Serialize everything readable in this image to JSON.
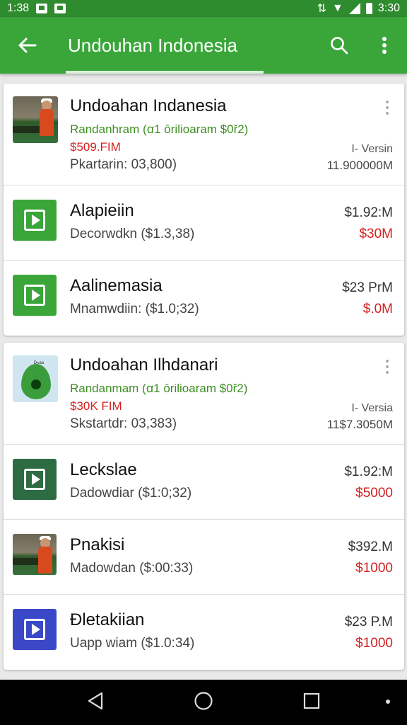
{
  "status": {
    "time_left": "1:38",
    "time_right": "3:30"
  },
  "appbar": {
    "title": "Undouhan Indonesia"
  },
  "cards": [
    {
      "rows": [
        {
          "kind": "featured",
          "icon": "photo",
          "name": "Undoahan Indanesia",
          "subtitle": "Randanhram (ꭤ1 ōrilioaram $0ř2)",
          "price": "$509.FIM",
          "meta": "Pkartarin: 03,800)",
          "version": "I- Versin",
          "size": "11.900000M"
        },
        {
          "kind": "app",
          "icon": "play-green",
          "name": "Alapieiin",
          "meta": "Decorwdkn ($1.3,38)",
          "right_price": "$1.92:M",
          "right_red": "$30M"
        },
        {
          "kind": "app",
          "icon": "play-green",
          "name": "Aalinemasia",
          "meta": "Mnamwdiin: ($1.0;32)",
          "right_price": "$23 PrM",
          "right_red": "$.0M"
        }
      ]
    },
    {
      "rows": [
        {
          "kind": "featured",
          "icon": "drop",
          "name": "Undoahan Ilhdanari",
          "subtitle": "Randanmam (ꭤ1 ōrilioaram $0ř2)",
          "price": "$30K FIM",
          "meta": "Skstartdr: 03,383)",
          "version": "I- Versia",
          "size": "11$7.3050M"
        },
        {
          "kind": "app",
          "icon": "play-dark",
          "name": "Leckslae",
          "meta": "Dadowdiar ($1:0;32)",
          "right_price": "$1.92:M",
          "right_red": "$5000"
        },
        {
          "kind": "app",
          "icon": "photo",
          "name": "Pnakisi",
          "meta": "Madowdan ($:00:33)",
          "right_price": "$392.M",
          "right_red": "$1000"
        },
        {
          "kind": "app",
          "icon": "play-blue",
          "name": "Ðletakiian",
          "meta": "Uapp wiam ($1.0:34)",
          "right_price": "$23 P.M",
          "right_red": "$1000"
        }
      ]
    }
  ]
}
